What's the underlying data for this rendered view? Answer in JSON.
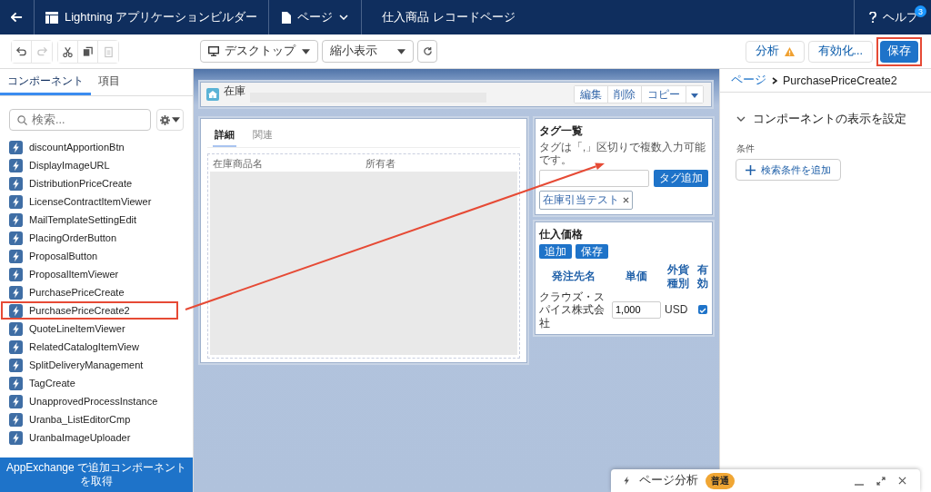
{
  "app_bar": {
    "app_title": "Lightning アプリケーションビルダー",
    "page_menu": "ページ",
    "page_name": "仕入商品 レコードページ",
    "help": "ヘルプ",
    "help_badge": "3"
  },
  "toolbar": {
    "edit_buttons": [
      {
        "kind": "undo",
        "disabled": false
      },
      {
        "kind": "redo",
        "disabled": true
      },
      {
        "kind": "cut",
        "disabled": false
      },
      {
        "kind": "copy",
        "disabled": false
      },
      {
        "kind": "paste",
        "disabled": true
      }
    ],
    "device": "デスクトップ",
    "zoom": "縮小表示",
    "analyze": {
      "label": "分析",
      "warning": true
    },
    "activate": "有効化...",
    "save": {
      "label": "保存",
      "highlighted": true
    }
  },
  "left_panel": {
    "tabs": [
      {
        "label": "コンポーネント",
        "selected": true
      },
      {
        "label": "項目",
        "selected": false
      }
    ],
    "search": {
      "placeholder": "検索..."
    },
    "components": [
      {
        "name": "discountApportionBtn",
        "highlighted": false
      },
      {
        "name": "DisplayImageURL",
        "highlighted": false
      },
      {
        "name": "DistributionPriceCreate",
        "highlighted": false
      },
      {
        "name": "LicenseContractItemViewer",
        "highlighted": false
      },
      {
        "name": "MailTemplateSettingEdit",
        "highlighted": false
      },
      {
        "name": "PlacingOrderButton",
        "highlighted": false
      },
      {
        "name": "ProposalButton",
        "highlighted": false
      },
      {
        "name": "ProposalItemViewer",
        "highlighted": false
      },
      {
        "name": "PurchasePriceCreate",
        "highlighted": false
      },
      {
        "name": "PurchasePriceCreate2",
        "highlighted": true
      },
      {
        "name": "QuoteLineItemViewer",
        "highlighted": false
      },
      {
        "name": "RelatedCatalogItemView",
        "highlighted": false
      },
      {
        "name": "SplitDeliveryManagement",
        "highlighted": false
      },
      {
        "name": "TagCreate",
        "highlighted": false
      },
      {
        "name": "UnapprovedProcessInstance",
        "highlighted": false
      },
      {
        "name": "Uranba_ListEditorCmp",
        "highlighted": false
      },
      {
        "name": "UranbaImageUploader",
        "highlighted": false
      }
    ],
    "appexchange": "AppExchange で追加コンポーネントを取得"
  },
  "canvas": {
    "header": {
      "object": "在庫",
      "buttons": [
        "編集",
        "削除",
        "コピー"
      ]
    },
    "detail_tabs": [
      {
        "label": "詳細",
        "selected": true
      },
      {
        "label": "関連",
        "selected": false
      }
    ],
    "fields": [
      "在庫商品名",
      "所有者"
    ],
    "tags": {
      "title": "タグ一覧",
      "hint": "タグは「,」区切りで複数入力可能です。",
      "button": "タグ追加",
      "chips": [
        "在庫引当テスト"
      ]
    },
    "prices": {
      "title": "仕入価格",
      "buttons": [
        "追加",
        "保存"
      ],
      "columns": [
        "発注先名",
        "単価",
        "外貨種別",
        "有効"
      ],
      "rows": [
        {
          "supplier": "クラウズ・スパイス株式会社",
          "price": "1,000",
          "currency": "USD",
          "active": true
        }
      ]
    }
  },
  "right_panel": {
    "breadcrumb": "ページ",
    "current": "PurchasePriceCreate2",
    "section": "コンポーネントの表示を設定",
    "expanded": true,
    "condition_label": "条件",
    "add_filter": "検索条件を追加"
  },
  "page_analysis": {
    "title": "ページ分析",
    "status": "普通"
  }
}
